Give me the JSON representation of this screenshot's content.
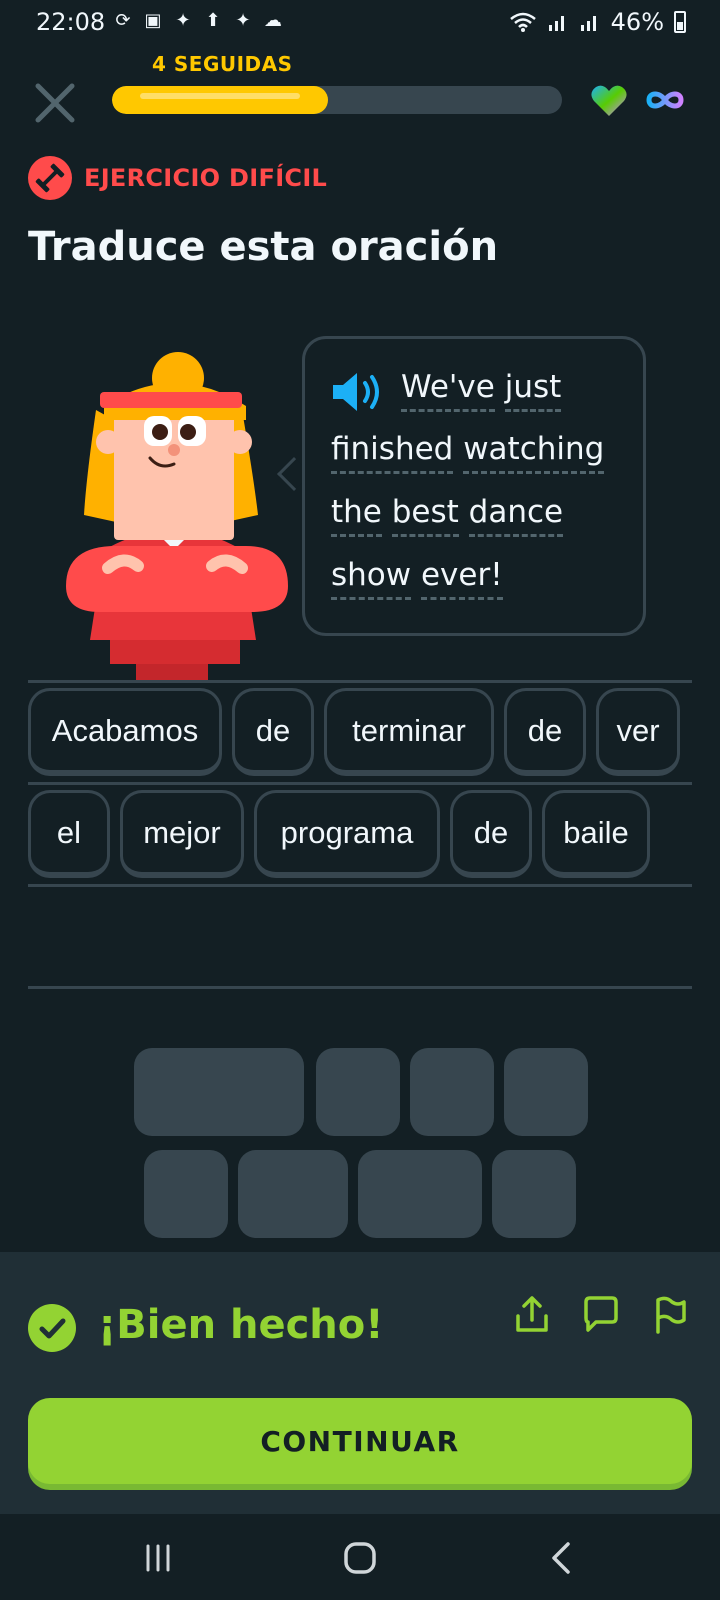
{
  "status_bar": {
    "time": "22:08",
    "battery": "46%",
    "left_icons": [
      "sync-icon",
      "image-icon",
      "maple-leaf-icon",
      "upload-icon",
      "maple-leaf-icon",
      "cloud-icon"
    ],
    "right_icons": [
      "wifi-icon",
      "signal-icon",
      "signal-icon",
      "battery-icon"
    ]
  },
  "header": {
    "streak_label": "4 SEGUIDAS",
    "progress_fraction": 0.48,
    "progress_color": "#ffc800"
  },
  "exercise": {
    "badge_label": "EJERCICIO DIFÍCIL",
    "title": "Traduce esta oración"
  },
  "prompt": {
    "lines": [
      [
        "We've",
        "just"
      ],
      [
        "finished",
        "watching"
      ],
      [
        "the",
        "best",
        "dance"
      ],
      [
        "show",
        "ever!"
      ]
    ]
  },
  "answer": {
    "rows": [
      [
        "Acabamos",
        "de",
        "terminar",
        "de",
        "ver"
      ],
      [
        "el",
        "mejor",
        "programa",
        "de",
        "baile"
      ]
    ]
  },
  "feedback": {
    "message": "¡Bien hecho!",
    "continue_label": "CONTINUAR",
    "accent": "#93d333"
  }
}
